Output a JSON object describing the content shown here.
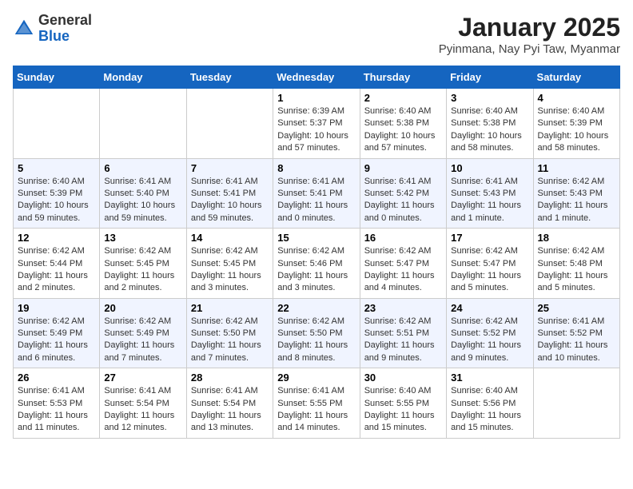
{
  "header": {
    "logo": {
      "general": "General",
      "blue": "Blue"
    },
    "title": "January 2025",
    "location": "Pyinmana, Nay Pyi Taw, Myanmar"
  },
  "weekdays": [
    "Sunday",
    "Monday",
    "Tuesday",
    "Wednesday",
    "Thursday",
    "Friday",
    "Saturday"
  ],
  "weeks": [
    [
      {
        "day": "",
        "info": ""
      },
      {
        "day": "",
        "info": ""
      },
      {
        "day": "",
        "info": ""
      },
      {
        "day": "1",
        "info": "Sunrise: 6:39 AM\nSunset: 5:37 PM\nDaylight: 10 hours and 57 minutes."
      },
      {
        "day": "2",
        "info": "Sunrise: 6:40 AM\nSunset: 5:38 PM\nDaylight: 10 hours and 57 minutes."
      },
      {
        "day": "3",
        "info": "Sunrise: 6:40 AM\nSunset: 5:38 PM\nDaylight: 10 hours and 58 minutes."
      },
      {
        "day": "4",
        "info": "Sunrise: 6:40 AM\nSunset: 5:39 PM\nDaylight: 10 hours and 58 minutes."
      }
    ],
    [
      {
        "day": "5",
        "info": "Sunrise: 6:40 AM\nSunset: 5:39 PM\nDaylight: 10 hours and 59 minutes."
      },
      {
        "day": "6",
        "info": "Sunrise: 6:41 AM\nSunset: 5:40 PM\nDaylight: 10 hours and 59 minutes."
      },
      {
        "day": "7",
        "info": "Sunrise: 6:41 AM\nSunset: 5:41 PM\nDaylight: 10 hours and 59 minutes."
      },
      {
        "day": "8",
        "info": "Sunrise: 6:41 AM\nSunset: 5:41 PM\nDaylight: 11 hours and 0 minutes."
      },
      {
        "day": "9",
        "info": "Sunrise: 6:41 AM\nSunset: 5:42 PM\nDaylight: 11 hours and 0 minutes."
      },
      {
        "day": "10",
        "info": "Sunrise: 6:41 AM\nSunset: 5:43 PM\nDaylight: 11 hours and 1 minute."
      },
      {
        "day": "11",
        "info": "Sunrise: 6:42 AM\nSunset: 5:43 PM\nDaylight: 11 hours and 1 minute."
      }
    ],
    [
      {
        "day": "12",
        "info": "Sunrise: 6:42 AM\nSunset: 5:44 PM\nDaylight: 11 hours and 2 minutes."
      },
      {
        "day": "13",
        "info": "Sunrise: 6:42 AM\nSunset: 5:45 PM\nDaylight: 11 hours and 2 minutes."
      },
      {
        "day": "14",
        "info": "Sunrise: 6:42 AM\nSunset: 5:45 PM\nDaylight: 11 hours and 3 minutes."
      },
      {
        "day": "15",
        "info": "Sunrise: 6:42 AM\nSunset: 5:46 PM\nDaylight: 11 hours and 3 minutes."
      },
      {
        "day": "16",
        "info": "Sunrise: 6:42 AM\nSunset: 5:47 PM\nDaylight: 11 hours and 4 minutes."
      },
      {
        "day": "17",
        "info": "Sunrise: 6:42 AM\nSunset: 5:47 PM\nDaylight: 11 hours and 5 minutes."
      },
      {
        "day": "18",
        "info": "Sunrise: 6:42 AM\nSunset: 5:48 PM\nDaylight: 11 hours and 5 minutes."
      }
    ],
    [
      {
        "day": "19",
        "info": "Sunrise: 6:42 AM\nSunset: 5:49 PM\nDaylight: 11 hours and 6 minutes."
      },
      {
        "day": "20",
        "info": "Sunrise: 6:42 AM\nSunset: 5:49 PM\nDaylight: 11 hours and 7 minutes."
      },
      {
        "day": "21",
        "info": "Sunrise: 6:42 AM\nSunset: 5:50 PM\nDaylight: 11 hours and 7 minutes."
      },
      {
        "day": "22",
        "info": "Sunrise: 6:42 AM\nSunset: 5:50 PM\nDaylight: 11 hours and 8 minutes."
      },
      {
        "day": "23",
        "info": "Sunrise: 6:42 AM\nSunset: 5:51 PM\nDaylight: 11 hours and 9 minutes."
      },
      {
        "day": "24",
        "info": "Sunrise: 6:42 AM\nSunset: 5:52 PM\nDaylight: 11 hours and 9 minutes."
      },
      {
        "day": "25",
        "info": "Sunrise: 6:41 AM\nSunset: 5:52 PM\nDaylight: 11 hours and 10 minutes."
      }
    ],
    [
      {
        "day": "26",
        "info": "Sunrise: 6:41 AM\nSunset: 5:53 PM\nDaylight: 11 hours and 11 minutes."
      },
      {
        "day": "27",
        "info": "Sunrise: 6:41 AM\nSunset: 5:54 PM\nDaylight: 11 hours and 12 minutes."
      },
      {
        "day": "28",
        "info": "Sunrise: 6:41 AM\nSunset: 5:54 PM\nDaylight: 11 hours and 13 minutes."
      },
      {
        "day": "29",
        "info": "Sunrise: 6:41 AM\nSunset: 5:55 PM\nDaylight: 11 hours and 14 minutes."
      },
      {
        "day": "30",
        "info": "Sunrise: 6:40 AM\nSunset: 5:55 PM\nDaylight: 11 hours and 15 minutes."
      },
      {
        "day": "31",
        "info": "Sunrise: 6:40 AM\nSunset: 5:56 PM\nDaylight: 11 hours and 15 minutes."
      },
      {
        "day": "",
        "info": ""
      }
    ]
  ]
}
